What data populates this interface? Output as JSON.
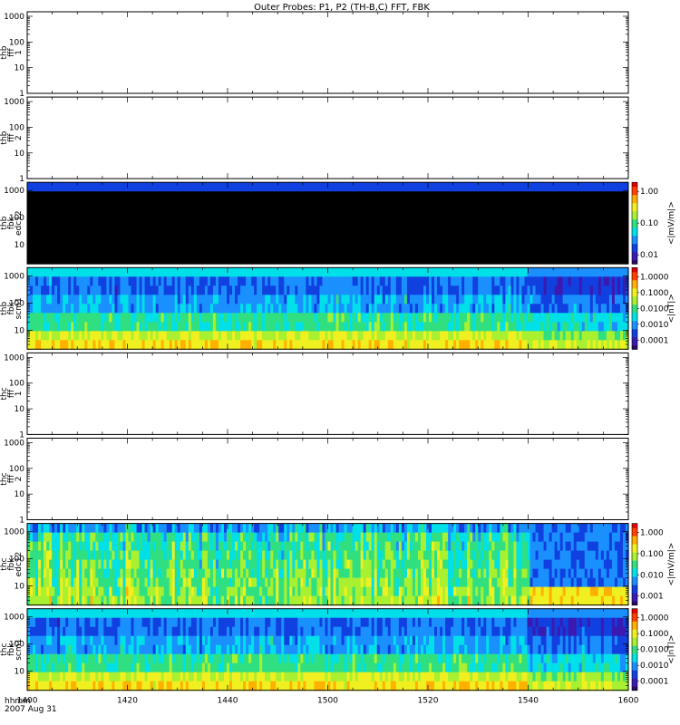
{
  "title": "Outer Probes: P1, P2 (TH-B,C) FFT, FBK",
  "time_axis": {
    "label_line1": "hhmm",
    "label_line2": "2007 Aug 31",
    "ticks": [
      "1400",
      "1420",
      "1440",
      "1500",
      "1520",
      "1540",
      "1600"
    ],
    "range": [
      0,
      120
    ]
  },
  "colors": {
    "colormap": [
      "#2a0a60",
      "#3a1ab0",
      "#1040e0",
      "#1a90ff",
      "#00e0e8",
      "#30e080",
      "#a8f030",
      "#f0f020",
      "#ffb000",
      "#ff4000",
      "#e00000"
    ]
  },
  "chart_data": [
    {
      "type": "heatmap",
      "id": "p1",
      "ylabel": [
        "thb",
        "fff",
        "1"
      ],
      "yticks": [
        "1000",
        "100",
        "10",
        "1"
      ],
      "ylim": [
        1,
        1500
      ],
      "ylog": true,
      "filled": false,
      "colorbar": null
    },
    {
      "type": "heatmap",
      "id": "p2",
      "ylabel": [
        "thb",
        "fff",
        "2"
      ],
      "yticks": [
        "1000",
        "100",
        "10",
        "1"
      ],
      "ylim": [
        1,
        1500
      ],
      "ylog": true,
      "filled": false,
      "colorbar": null
    },
    {
      "type": "heatmap",
      "id": "p3",
      "ylabel": [
        "thb",
        "fbk",
        "edc12"
      ],
      "yticks": [
        "1000",
        "100",
        "10"
      ],
      "ylim": [
        2,
        2000
      ],
      "ylog": true,
      "filled": true,
      "pattern": "black",
      "colorbar": {
        "label": "<|mV/m|>",
        "ticks": [
          "1.00",
          "0.10",
          "0.01"
        ]
      }
    },
    {
      "type": "heatmap",
      "id": "p4",
      "ylabel": [
        "thb",
        "fbk",
        "scm1"
      ],
      "yticks": [
        "1000",
        "100",
        "10"
      ],
      "ylim": [
        2,
        2000
      ],
      "ylog": true,
      "filled": true,
      "pattern": "scm",
      "colorbar": {
        "label": "<|nT|>",
        "ticks": [
          "1.0000",
          "0.1000",
          "0.0100",
          "0.0010",
          "0.0001"
        ]
      }
    },
    {
      "type": "heatmap",
      "id": "p5",
      "ylabel": [
        "thc",
        "fff",
        "1"
      ],
      "yticks": [
        "1000",
        "100",
        "10",
        "1"
      ],
      "ylim": [
        1,
        1500
      ],
      "ylog": true,
      "filled": false,
      "colorbar": null
    },
    {
      "type": "heatmap",
      "id": "p6",
      "ylabel": [
        "thc",
        "fff",
        "2"
      ],
      "yticks": [
        "1000",
        "100",
        "10",
        "1"
      ],
      "ylim": [
        1,
        1500
      ],
      "ylog": true,
      "filled": false,
      "colorbar": null
    },
    {
      "type": "heatmap",
      "id": "p7",
      "ylabel": [
        "thc",
        "fbk",
        "edc12"
      ],
      "yticks": [
        "1000",
        "100",
        "10"
      ],
      "ylim": [
        2,
        2000
      ],
      "ylog": true,
      "filled": true,
      "pattern": "edc",
      "colorbar": {
        "label": "<|mV/m|>",
        "ticks": [
          "1.000",
          "0.100",
          "0.010",
          "0.001"
        ]
      }
    },
    {
      "type": "heatmap",
      "id": "p8",
      "ylabel": [
        "thc",
        "fbk",
        "scm1"
      ],
      "yticks": [
        "1000",
        "100",
        "10"
      ],
      "ylim": [
        2,
        2000
      ],
      "ylog": true,
      "filled": true,
      "pattern": "scm",
      "colorbar": {
        "label": "<|nT|>",
        "ticks": [
          "1.0000",
          "0.1000",
          "0.0100",
          "0.0010",
          "0.0001"
        ]
      }
    }
  ]
}
